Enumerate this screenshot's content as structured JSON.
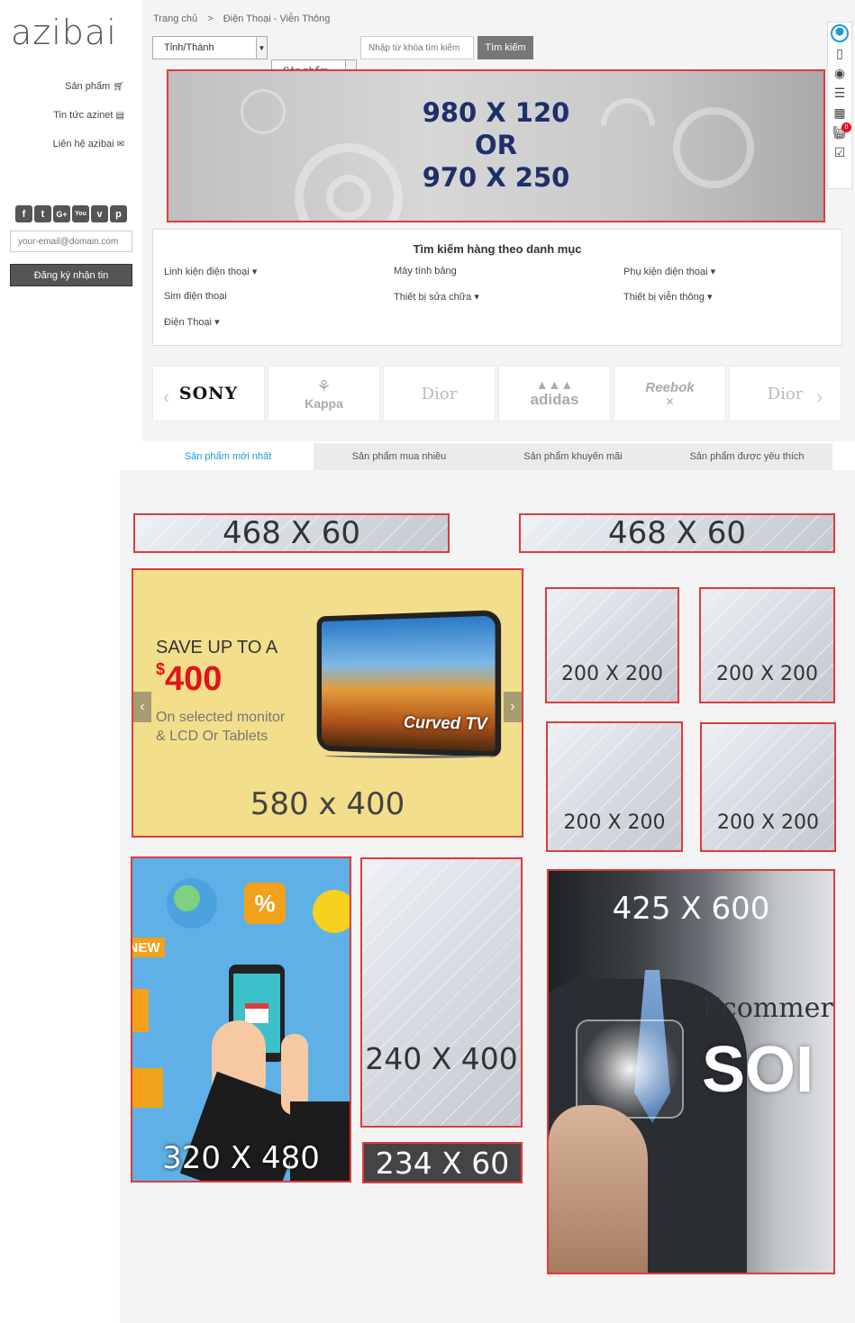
{
  "logo": "azibai",
  "sidebar": {
    "links": [
      {
        "label": "Sản phẩm",
        "icon": "cart-icon"
      },
      {
        "label": "Tin tức azinet",
        "icon": "news-icon"
      },
      {
        "label": "Liên hệ azibai",
        "icon": "contact-icon"
      }
    ],
    "social": [
      "facebook-icon",
      "twitter-icon",
      "google-plus-icon",
      "youtube-icon",
      "vimeo-icon",
      "pinterest-icon"
    ],
    "email_placeholder": "your-email@domain.com",
    "subscribe_label": "Đăng ký nhận tin"
  },
  "breadcrumb": {
    "home": "Trang chủ",
    "sep": ">",
    "current": "Điện Thoại - Viễn Thông"
  },
  "search": {
    "province": "Tỉnh/Thành",
    "type": "Sản phẩm",
    "placeholder": "Nhập từ khóa tìm kiếm",
    "button": "Tìm kiếm"
  },
  "top_banner": {
    "line1": "980 X 120",
    "line2": "OR",
    "line3": "970 X 250"
  },
  "categories": {
    "title": "Tìm kiếm hàng theo danh mục",
    "items": [
      {
        "label": "Linh kiện điện thoại",
        "dropdown": true
      },
      {
        "label": "Máy tính bảng",
        "dropdown": false
      },
      {
        "label": "Phụ kiện điện thoại",
        "dropdown": true
      },
      {
        "label": "Sim điện thoại",
        "dropdown": false
      },
      {
        "label": "Thiết bị sửa chữa",
        "dropdown": true
      },
      {
        "label": "Thiết bị viễn thông",
        "dropdown": true
      },
      {
        "label": "Điện Thoại",
        "dropdown": true
      }
    ]
  },
  "brands": [
    "SONY",
    "Kappa",
    "Dior",
    "adidas",
    "Reebok",
    "Dior"
  ],
  "tabs": [
    "Sản phẩm mới nhất",
    "Sản phẩm mua nhiều",
    "Sản phẩm khuyến mãi",
    "Sản phẩm được yêu thích"
  ],
  "ads": {
    "leader_left": "468 X 60",
    "leader_right": "468 X 60",
    "promo": {
      "line1": "SAVE UP TO A",
      "currency": "$",
      "amount": "400",
      "line2": "On selected monitor",
      "line3": "& LCD Or Tablets",
      "tv_label": "Curved TV",
      "size": "580 x 400"
    },
    "squares": [
      "200 X 200",
      "200 X 200",
      "200 X 200",
      "200 X 200"
    ],
    "mobile": {
      "badge": "NEW",
      "percent": "%",
      "size": "320 X 480"
    },
    "tall": "240 X 400",
    "small": "234 X 60",
    "large": {
      "size": "425 X 600",
      "word1": "Ecommerc",
      "word2": "SOI"
    }
  },
  "right_toolbar": {
    "icons": [
      "user-icon",
      "document-icon",
      "eye-icon",
      "list-icon",
      "calendar-icon",
      "basket-icon",
      "checklist-icon"
    ],
    "basket_count": "0"
  },
  "colors": {
    "accent": "#1a9ad6",
    "ad_border": "#e23a3a",
    "promo_bg": "#f3df8b",
    "promo_red": "#e3121b",
    "banner_text": "#1f2f6b"
  }
}
